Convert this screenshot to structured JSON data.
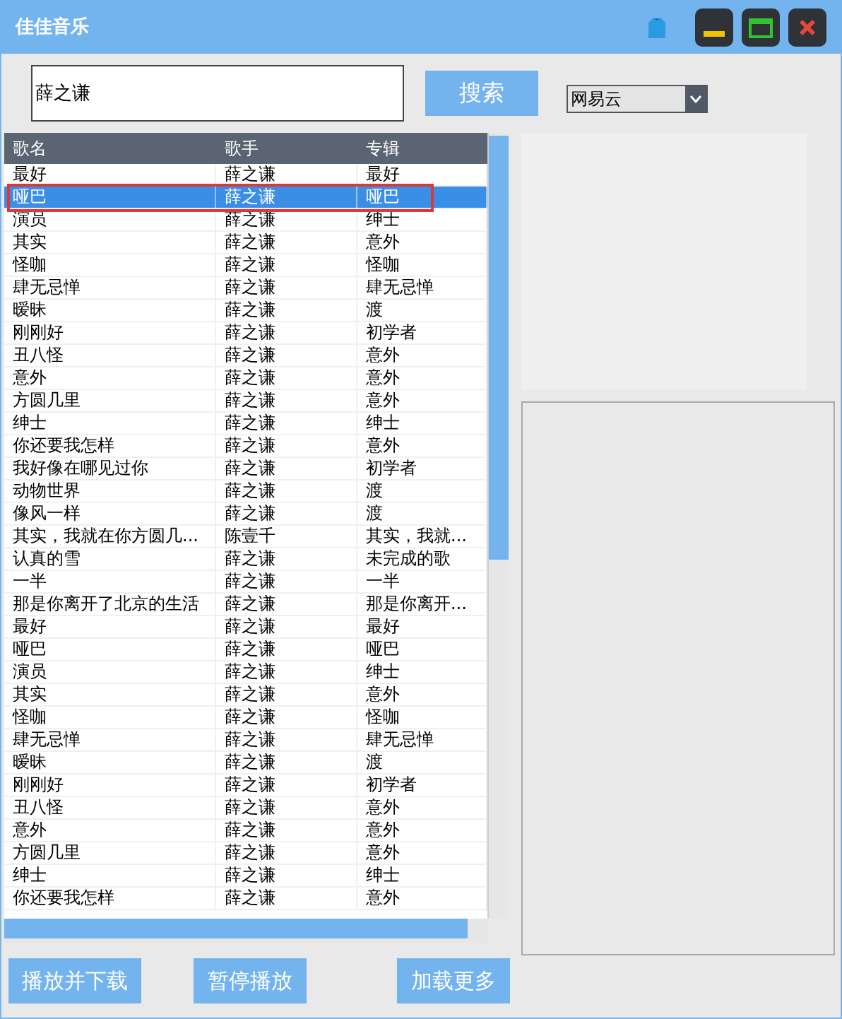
{
  "window": {
    "title": "佳佳音乐"
  },
  "search": {
    "value": "薛之谦",
    "button": "搜索",
    "source": "网易云"
  },
  "table": {
    "columns": [
      "歌名",
      "歌手",
      "专辑"
    ],
    "rows": [
      {
        "name": "最好",
        "singer": "薛之谦",
        "album": "最好",
        "selected": false
      },
      {
        "name": "哑巴",
        "singer": "薛之谦",
        "album": "哑巴",
        "selected": true
      },
      {
        "name": "演员",
        "singer": "薛之谦",
        "album": "绅士",
        "selected": false
      },
      {
        "name": "其实",
        "singer": "薛之谦",
        "album": "意外",
        "selected": false
      },
      {
        "name": "怪咖",
        "singer": "薛之谦",
        "album": "怪咖",
        "selected": false
      },
      {
        "name": "肆无忌惮",
        "singer": "薛之谦",
        "album": "肆无忌惮",
        "selected": false
      },
      {
        "name": "暧昧",
        "singer": "薛之谦",
        "album": "渡",
        "selected": false
      },
      {
        "name": "刚刚好",
        "singer": "薛之谦",
        "album": "初学者",
        "selected": false
      },
      {
        "name": "丑八怪",
        "singer": "薛之谦",
        "album": "意外",
        "selected": false
      },
      {
        "name": "意外",
        "singer": "薛之谦",
        "album": "意外",
        "selected": false
      },
      {
        "name": "方圆几里",
        "singer": "薛之谦",
        "album": "意外",
        "selected": false
      },
      {
        "name": "绅士",
        "singer": "薛之谦",
        "album": "绅士",
        "selected": false
      },
      {
        "name": "你还要我怎样",
        "singer": "薛之谦",
        "album": "意外",
        "selected": false
      },
      {
        "name": "我好像在哪见过你",
        "singer": "薛之谦",
        "album": "初学者",
        "selected": false
      },
      {
        "name": "动物世界",
        "singer": "薛之谦",
        "album": "渡",
        "selected": false
      },
      {
        "name": "像风一样",
        "singer": "薛之谦",
        "album": "渡",
        "selected": false
      },
      {
        "name": "其实，我就在你方圆几...",
        "singer": "陈壹千",
        "album": "其实，我就...",
        "selected": false
      },
      {
        "name": "认真的雪",
        "singer": "薛之谦",
        "album": "未完成的歌",
        "selected": false
      },
      {
        "name": "一半",
        "singer": "薛之谦",
        "album": "一半",
        "selected": false
      },
      {
        "name": "那是你离开了北京的生活",
        "singer": "薛之谦",
        "album": "那是你离开...",
        "selected": false
      },
      {
        "name": "最好",
        "singer": "薛之谦",
        "album": "最好",
        "selected": false
      },
      {
        "name": "哑巴",
        "singer": "薛之谦",
        "album": "哑巴",
        "selected": false
      },
      {
        "name": "演员",
        "singer": "薛之谦",
        "album": "绅士",
        "selected": false
      },
      {
        "name": "其实",
        "singer": "薛之谦",
        "album": "意外",
        "selected": false
      },
      {
        "name": "怪咖",
        "singer": "薛之谦",
        "album": "怪咖",
        "selected": false
      },
      {
        "name": "肆无忌惮",
        "singer": "薛之谦",
        "album": "肆无忌惮",
        "selected": false
      },
      {
        "name": "暧昧",
        "singer": "薛之谦",
        "album": "渡",
        "selected": false
      },
      {
        "name": "刚刚好",
        "singer": "薛之谦",
        "album": "初学者",
        "selected": false
      },
      {
        "name": "丑八怪",
        "singer": "薛之谦",
        "album": "意外",
        "selected": false
      },
      {
        "name": "意外",
        "singer": "薛之谦",
        "album": "意外",
        "selected": false
      },
      {
        "name": "方圆几里",
        "singer": "薛之谦",
        "album": "意外",
        "selected": false
      },
      {
        "name": "绅士",
        "singer": "薛之谦",
        "album": "绅士",
        "selected": false
      },
      {
        "name": "你还要我怎样",
        "singer": "薛之谦",
        "album": "意外",
        "selected": false
      }
    ]
  },
  "buttons": [
    "播放并下载",
    "暂停播放",
    "加载更多"
  ]
}
